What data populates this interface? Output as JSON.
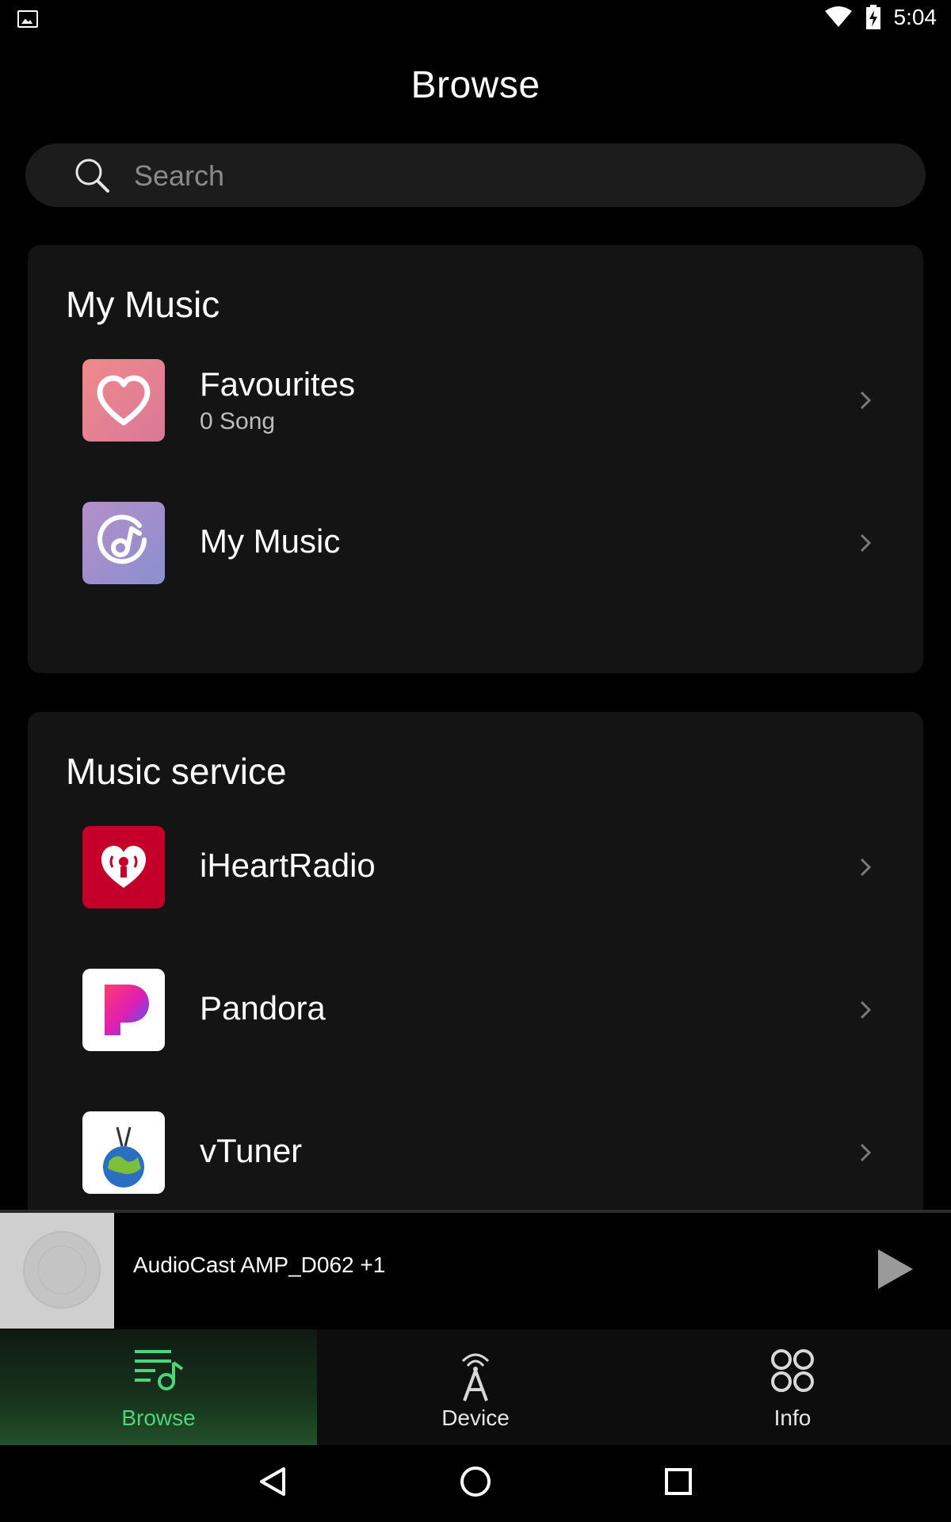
{
  "status_bar": {
    "time": "5:04",
    "icons": [
      "image-icon",
      "wifi-icon",
      "battery-charging-icon"
    ]
  },
  "header": {
    "title": "Browse"
  },
  "search": {
    "placeholder": "Search",
    "value": ""
  },
  "sections": {
    "my_music": {
      "title": "My Music",
      "items": [
        {
          "label": "Favourites",
          "sublabel": "0 Song",
          "icon": "heart-icon"
        },
        {
          "label": "My Music",
          "icon": "music-note-icon"
        }
      ]
    },
    "music_service": {
      "title": "Music service",
      "items": [
        {
          "label": "iHeartRadio",
          "icon": "iheartradio-logo"
        },
        {
          "label": "Pandora",
          "icon": "pandora-logo"
        },
        {
          "label": "vTuner",
          "icon": "vtuner-logo"
        }
      ]
    }
  },
  "now_playing": {
    "track": "AudioCast AMP_D062  +1"
  },
  "tabs": [
    {
      "label": "Browse",
      "icon": "browse-icon",
      "active": true
    },
    {
      "label": "Device",
      "icon": "antenna-icon",
      "active": false
    },
    {
      "label": "Info",
      "icon": "grid-icon",
      "active": false
    }
  ],
  "colors": {
    "accent": "#4ed47a",
    "card": "#141414",
    "background": "#000000"
  }
}
